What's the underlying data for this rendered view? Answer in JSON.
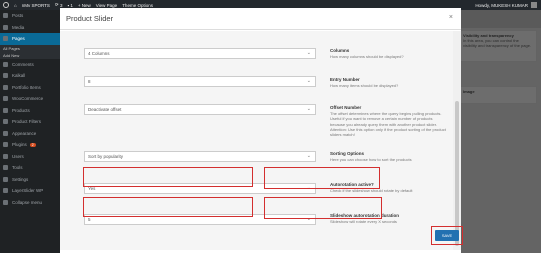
{
  "adminbar": {
    "site_name": "nMv SPORTS",
    "updates": "3",
    "comments": "1",
    "new_label": "+ New",
    "view_page": "View Page",
    "theme_options": "Theme Options",
    "greeting": "Howdy, MUKESH KUMAR"
  },
  "sidebar": {
    "items": [
      {
        "label": "Posts"
      },
      {
        "label": "Media"
      },
      {
        "label": "Pages",
        "active": true
      },
      {
        "label": "All Pages",
        "sub": true
      },
      {
        "label": "Add New",
        "sub": true
      },
      {
        "label": "Comments"
      },
      {
        "label": "Kalkall"
      },
      {
        "label": "Portfolio Items"
      },
      {
        "label": "WooCommerce"
      },
      {
        "label": "Products"
      },
      {
        "label": "Product Filters"
      },
      {
        "label": "Appearance"
      },
      {
        "label": "Plugins",
        "badge": "2"
      },
      {
        "label": "Users"
      },
      {
        "label": "Tools"
      },
      {
        "label": "Settings"
      },
      {
        "label": "LayerSlider WP"
      },
      {
        "label": "Collapse menu"
      }
    ]
  },
  "background": {
    "box1_title": "Visibility and transparency",
    "box1_text": "In this area, you can control the visibility and transparency of the page.",
    "box2_title": "Image"
  },
  "modal": {
    "title": "Product Slider",
    "close": "×",
    "rows": [
      {
        "value": "4 Columns",
        "title": "Columns",
        "desc": "How many columns should be displayed?"
      },
      {
        "value": "8",
        "title": "Entry Number",
        "desc": "How many items should be displayed?"
      },
      {
        "value": "Deactivate offset",
        "title": "Offset Number",
        "desc": "The offset determines where the query begins pulling products. Useful if you want to remove a certain number of products because you already query them with another product slider. Attention: Use this option only if the product sorting of the product sliders match!"
      },
      {
        "value": "Sort by popularity",
        "title": "Sorting Options",
        "desc": "Here you can choose how to sort the products"
      },
      {
        "value": "Yes",
        "title": "Autorotation active?",
        "desc": "Check if the slideshow should rotate by default"
      },
      {
        "value": "5",
        "title": "Slideshow autorotation duration",
        "desc": "Slideshow will rotate every X seconds"
      }
    ],
    "save_label": "SAVE"
  }
}
